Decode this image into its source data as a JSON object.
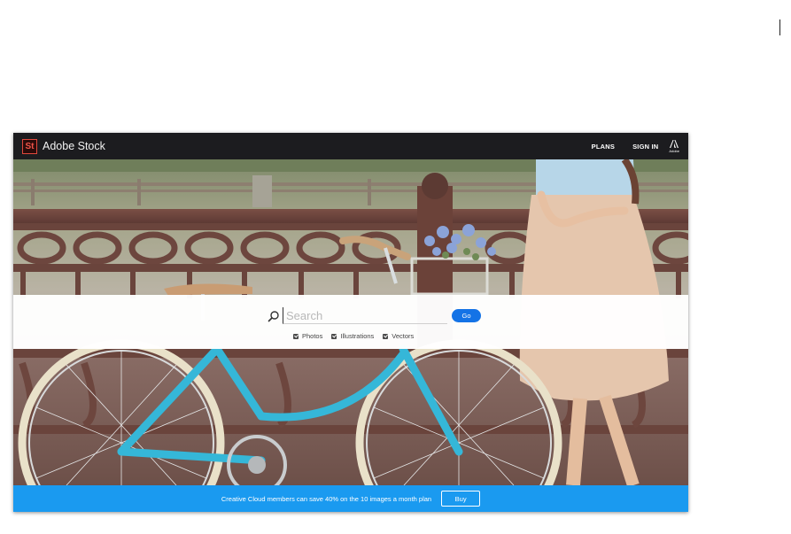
{
  "header": {
    "logo_text": "St",
    "brand_name": "Adobe Stock",
    "nav": [
      {
        "label": "PLANS"
      },
      {
        "label": "SIGN IN"
      }
    ],
    "adobe_wordmark": "Adobe"
  },
  "search": {
    "placeholder": "Search",
    "go_label": "Go",
    "filters": [
      {
        "label": "Photos",
        "checked": true
      },
      {
        "label": "Illustrations",
        "checked": true
      },
      {
        "label": "Vectors",
        "checked": true
      }
    ]
  },
  "hero": {
    "icons": [
      "background-photo-bicycle-woman"
    ]
  },
  "promo": {
    "text": "Creative Cloud members can save 40% on the 10 images a month plan",
    "buy_label": "Buy"
  },
  "colors": {
    "topbar": "#1c1c1f",
    "brand_red": "#e0483c",
    "go_blue": "#1473e6",
    "promo_blue": "#1a9af0"
  }
}
